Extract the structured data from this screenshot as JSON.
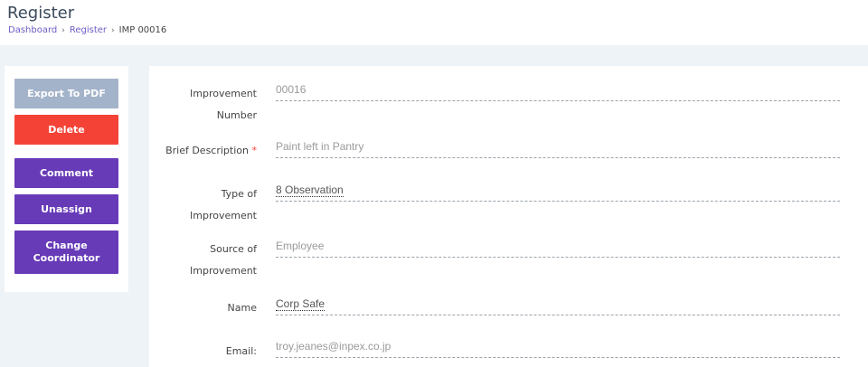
{
  "header": {
    "title": "Register",
    "breadcrumb": [
      "Dashboard",
      "Register",
      "IMP 00016"
    ]
  },
  "sidebar": {
    "export_label": "Export To PDF",
    "delete_label": "Delete",
    "comment_label": "Comment",
    "unassign_label": "Unassign",
    "change_label": "Change Coordinator"
  },
  "form": {
    "improvement_number": {
      "label": "Improvement Number",
      "value": "00016"
    },
    "brief_description": {
      "label": "Brief Description",
      "required_mark": "*",
      "value": "Paint left in Pantry"
    },
    "type_of_improvement": {
      "label": "Type of Improvement",
      "value": "8 Observation"
    },
    "source_of_improvement": {
      "label": "Source of Improvement",
      "value": "Employee"
    },
    "name": {
      "label": "Name",
      "value": "Corp Safe"
    },
    "email": {
      "label": "Email:",
      "value": "troy.jeanes@inpex.co.jp"
    }
  },
  "colors": {
    "accent": "#673ab7",
    "danger": "#f44336",
    "disabled": "#a3b3c9",
    "link": "#6f5bc4",
    "background": "#eef3f7"
  }
}
